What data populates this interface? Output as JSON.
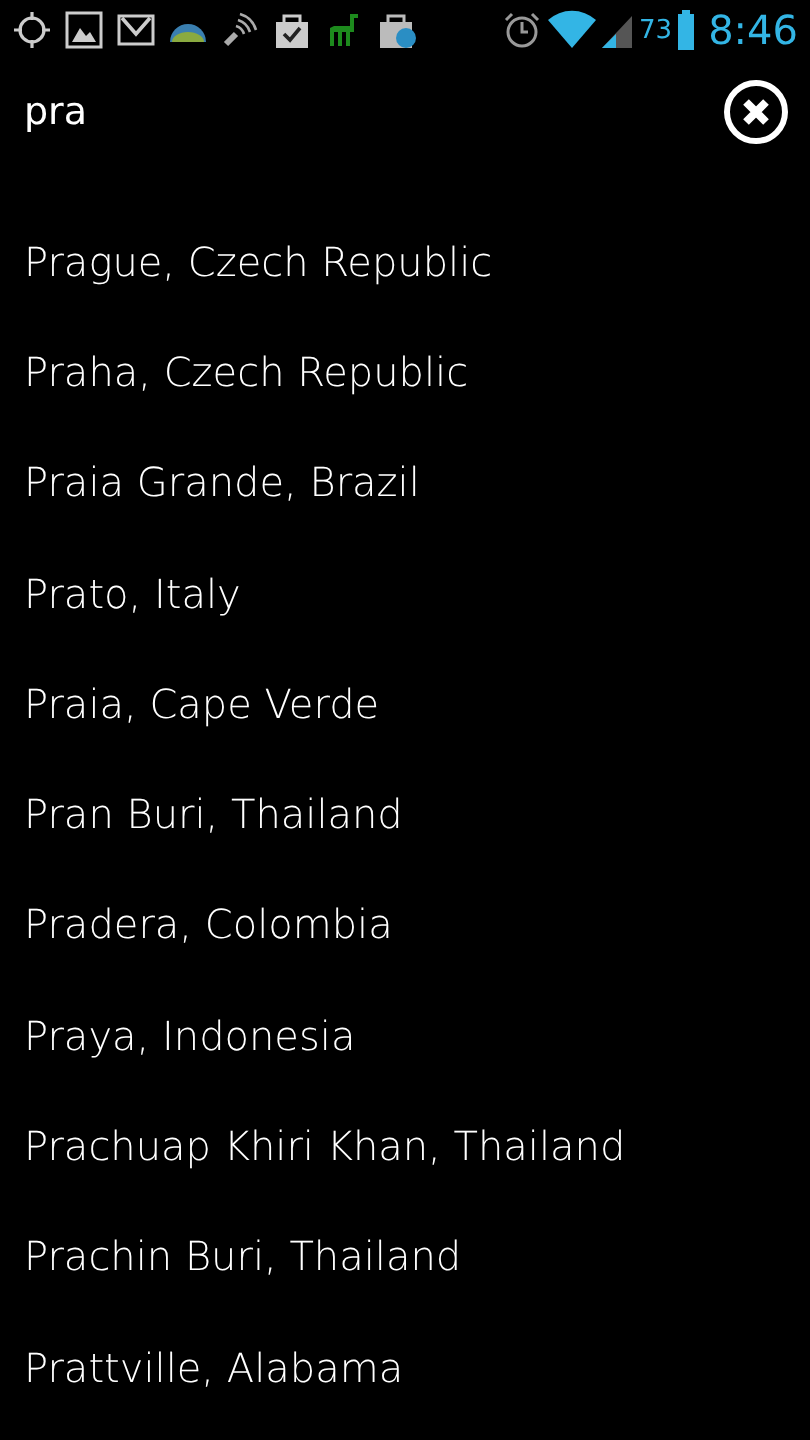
{
  "status_bar": {
    "battery": "73",
    "time": "8:46"
  },
  "search": {
    "value": "pra"
  },
  "results": [
    "Prague, Czech Republic",
    "Praha, Czech Republic",
    "Praia Grande, Brazil",
    "Prato, Italy",
    "Praia, Cape Verde",
    "Pran Buri, Thailand",
    "Pradera, Colombia",
    "Praya, Indonesia",
    "Prachuap Khiri Khan, Thailand",
    "Prachin Buri, Thailand",
    "Prattville, Alabama"
  ]
}
